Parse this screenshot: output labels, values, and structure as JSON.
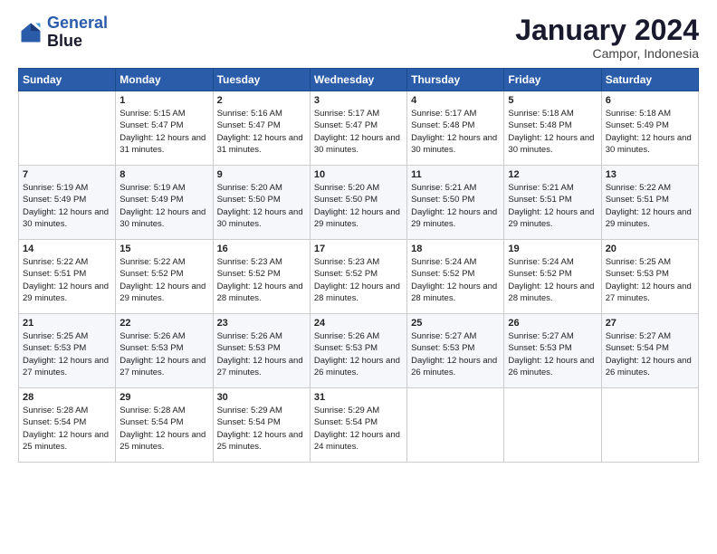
{
  "logo": {
    "line1": "General",
    "line2": "Blue"
  },
  "title": "January 2024",
  "subtitle": "Campor, Indonesia",
  "days_header": [
    "Sunday",
    "Monday",
    "Tuesday",
    "Wednesday",
    "Thursday",
    "Friday",
    "Saturday"
  ],
  "weeks": [
    [
      {
        "day": "",
        "sunrise": "",
        "sunset": "",
        "daylight": ""
      },
      {
        "day": "1",
        "sunrise": "Sunrise: 5:15 AM",
        "sunset": "Sunset: 5:47 PM",
        "daylight": "Daylight: 12 hours and 31 minutes."
      },
      {
        "day": "2",
        "sunrise": "Sunrise: 5:16 AM",
        "sunset": "Sunset: 5:47 PM",
        "daylight": "Daylight: 12 hours and 31 minutes."
      },
      {
        "day": "3",
        "sunrise": "Sunrise: 5:17 AM",
        "sunset": "Sunset: 5:47 PM",
        "daylight": "Daylight: 12 hours and 30 minutes."
      },
      {
        "day": "4",
        "sunrise": "Sunrise: 5:17 AM",
        "sunset": "Sunset: 5:48 PM",
        "daylight": "Daylight: 12 hours and 30 minutes."
      },
      {
        "day": "5",
        "sunrise": "Sunrise: 5:18 AM",
        "sunset": "Sunset: 5:48 PM",
        "daylight": "Daylight: 12 hours and 30 minutes."
      },
      {
        "day": "6",
        "sunrise": "Sunrise: 5:18 AM",
        "sunset": "Sunset: 5:49 PM",
        "daylight": "Daylight: 12 hours and 30 minutes."
      }
    ],
    [
      {
        "day": "7",
        "sunrise": "Sunrise: 5:19 AM",
        "sunset": "Sunset: 5:49 PM",
        "daylight": "Daylight: 12 hours and 30 minutes."
      },
      {
        "day": "8",
        "sunrise": "Sunrise: 5:19 AM",
        "sunset": "Sunset: 5:49 PM",
        "daylight": "Daylight: 12 hours and 30 minutes."
      },
      {
        "day": "9",
        "sunrise": "Sunrise: 5:20 AM",
        "sunset": "Sunset: 5:50 PM",
        "daylight": "Daylight: 12 hours and 30 minutes."
      },
      {
        "day": "10",
        "sunrise": "Sunrise: 5:20 AM",
        "sunset": "Sunset: 5:50 PM",
        "daylight": "Daylight: 12 hours and 29 minutes."
      },
      {
        "day": "11",
        "sunrise": "Sunrise: 5:21 AM",
        "sunset": "Sunset: 5:50 PM",
        "daylight": "Daylight: 12 hours and 29 minutes."
      },
      {
        "day": "12",
        "sunrise": "Sunrise: 5:21 AM",
        "sunset": "Sunset: 5:51 PM",
        "daylight": "Daylight: 12 hours and 29 minutes."
      },
      {
        "day": "13",
        "sunrise": "Sunrise: 5:22 AM",
        "sunset": "Sunset: 5:51 PM",
        "daylight": "Daylight: 12 hours and 29 minutes."
      }
    ],
    [
      {
        "day": "14",
        "sunrise": "Sunrise: 5:22 AM",
        "sunset": "Sunset: 5:51 PM",
        "daylight": "Daylight: 12 hours and 29 minutes."
      },
      {
        "day": "15",
        "sunrise": "Sunrise: 5:22 AM",
        "sunset": "Sunset: 5:52 PM",
        "daylight": "Daylight: 12 hours and 29 minutes."
      },
      {
        "day": "16",
        "sunrise": "Sunrise: 5:23 AM",
        "sunset": "Sunset: 5:52 PM",
        "daylight": "Daylight: 12 hours and 28 minutes."
      },
      {
        "day": "17",
        "sunrise": "Sunrise: 5:23 AM",
        "sunset": "Sunset: 5:52 PM",
        "daylight": "Daylight: 12 hours and 28 minutes."
      },
      {
        "day": "18",
        "sunrise": "Sunrise: 5:24 AM",
        "sunset": "Sunset: 5:52 PM",
        "daylight": "Daylight: 12 hours and 28 minutes."
      },
      {
        "day": "19",
        "sunrise": "Sunrise: 5:24 AM",
        "sunset": "Sunset: 5:52 PM",
        "daylight": "Daylight: 12 hours and 28 minutes."
      },
      {
        "day": "20",
        "sunrise": "Sunrise: 5:25 AM",
        "sunset": "Sunset: 5:53 PM",
        "daylight": "Daylight: 12 hours and 27 minutes."
      }
    ],
    [
      {
        "day": "21",
        "sunrise": "Sunrise: 5:25 AM",
        "sunset": "Sunset: 5:53 PM",
        "daylight": "Daylight: 12 hours and 27 minutes."
      },
      {
        "day": "22",
        "sunrise": "Sunrise: 5:26 AM",
        "sunset": "Sunset: 5:53 PM",
        "daylight": "Daylight: 12 hours and 27 minutes."
      },
      {
        "day": "23",
        "sunrise": "Sunrise: 5:26 AM",
        "sunset": "Sunset: 5:53 PM",
        "daylight": "Daylight: 12 hours and 27 minutes."
      },
      {
        "day": "24",
        "sunrise": "Sunrise: 5:26 AM",
        "sunset": "Sunset: 5:53 PM",
        "daylight": "Daylight: 12 hours and 26 minutes."
      },
      {
        "day": "25",
        "sunrise": "Sunrise: 5:27 AM",
        "sunset": "Sunset: 5:53 PM",
        "daylight": "Daylight: 12 hours and 26 minutes."
      },
      {
        "day": "26",
        "sunrise": "Sunrise: 5:27 AM",
        "sunset": "Sunset: 5:53 PM",
        "daylight": "Daylight: 12 hours and 26 minutes."
      },
      {
        "day": "27",
        "sunrise": "Sunrise: 5:27 AM",
        "sunset": "Sunset: 5:54 PM",
        "daylight": "Daylight: 12 hours and 26 minutes."
      }
    ],
    [
      {
        "day": "28",
        "sunrise": "Sunrise: 5:28 AM",
        "sunset": "Sunset: 5:54 PM",
        "daylight": "Daylight: 12 hours and 25 minutes."
      },
      {
        "day": "29",
        "sunrise": "Sunrise: 5:28 AM",
        "sunset": "Sunset: 5:54 PM",
        "daylight": "Daylight: 12 hours and 25 minutes."
      },
      {
        "day": "30",
        "sunrise": "Sunrise: 5:29 AM",
        "sunset": "Sunset: 5:54 PM",
        "daylight": "Daylight: 12 hours and 25 minutes."
      },
      {
        "day": "31",
        "sunrise": "Sunrise: 5:29 AM",
        "sunset": "Sunset: 5:54 PM",
        "daylight": "Daylight: 12 hours and 24 minutes."
      },
      {
        "day": "",
        "sunrise": "",
        "sunset": "",
        "daylight": ""
      },
      {
        "day": "",
        "sunrise": "",
        "sunset": "",
        "daylight": ""
      },
      {
        "day": "",
        "sunrise": "",
        "sunset": "",
        "daylight": ""
      }
    ]
  ]
}
